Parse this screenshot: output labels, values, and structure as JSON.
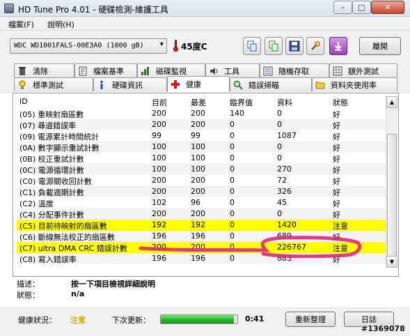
{
  "window": {
    "title": "HD Tune Pro 4.01 - 硬碟檢測-維護工具",
    "min_glyph": "–",
    "max_glyph": "□",
    "close_glyph": "✕"
  },
  "menu": {
    "items": [
      "檔案(F)",
      "說明(H)"
    ]
  },
  "toolbar": {
    "drive": "WDC WD1001FALS-00E3A0 (1000 gB)",
    "drive_arrow": "▼",
    "temperature": "45度C",
    "exit_label": "離開"
  },
  "tabs": {
    "row1": [
      "清除",
      "檔案基準",
      "磁碟監視",
      "工具",
      "隨機存取",
      "額外測試"
    ],
    "row2": [
      "標準測試",
      "硬碟資訊",
      "健康",
      "錯誤掃瞄",
      "資料夾使用率"
    ],
    "active": "健康"
  },
  "table": {
    "headers": [
      "ID",
      "目前",
      "最差",
      "臨界值",
      "資料",
      "狀態"
    ],
    "rows": [
      {
        "id": "(05) 重映射扇區數",
        "cur": "200",
        "worst": "200",
        "thr": "140",
        "data": "0",
        "status": "好"
      },
      {
        "id": "(07) 尋道錯誤率",
        "cur": "200",
        "worst": "200",
        "thr": "0",
        "data": "0",
        "status": "好"
      },
      {
        "id": "(09) 電源累計時間統計",
        "cur": "99",
        "worst": "99",
        "thr": "0",
        "data": "1087",
        "status": "好"
      },
      {
        "id": "(0A) 數字顯示重試計數",
        "cur": "100",
        "worst": "100",
        "thr": "0",
        "data": "0",
        "status": "好"
      },
      {
        "id": "(0B) 校正重試計數",
        "cur": "100",
        "worst": "100",
        "thr": "0",
        "data": "0",
        "status": "好"
      },
      {
        "id": "(0C) 電源循環計數",
        "cur": "100",
        "worst": "100",
        "thr": "0",
        "data": "270",
        "status": "好"
      },
      {
        "id": "(C0) 電源關收回計數",
        "cur": "200",
        "worst": "200",
        "thr": "0",
        "data": "72",
        "status": "好"
      },
      {
        "id": "(C1) 負載週期計數",
        "cur": "200",
        "worst": "200",
        "thr": "0",
        "data": "326",
        "status": "好"
      },
      {
        "id": "(C2) 溫度",
        "cur": "102",
        "worst": "96",
        "thr": "0",
        "data": "45",
        "status": "好"
      },
      {
        "id": "(C4) 分配事件計數",
        "cur": "200",
        "worst": "200",
        "thr": "0",
        "data": "0",
        "status": "好"
      },
      {
        "id": "(C5) 目前待映射的扇區數",
        "cur": "192",
        "worst": "192",
        "thr": "0",
        "data": "1420",
        "status": "注意",
        "warn": true
      },
      {
        "id": "(C6) 斷線無法校正的扇區數",
        "cur": "196",
        "worst": "196",
        "thr": "0",
        "data": "689",
        "status": "好"
      },
      {
        "id": "(C7) ultra DMA CRC 錯誤計數",
        "cur": "200",
        "worst": "200",
        "thr": "0",
        "data": "226767",
        "status": "注意",
        "warn": true
      },
      {
        "id": "(C8) 寫入錯誤率",
        "cur": "196",
        "worst": "196",
        "thr": "0",
        "data": "883",
        "status": "好"
      }
    ]
  },
  "details": {
    "desc_label": "描述：",
    "desc_value": "按一下項目檢視詳細說明",
    "status_label": "狀態：",
    "status_value": "n/a"
  },
  "statusbar": {
    "health_label": "健康狀況：",
    "health_value": "注意",
    "next_update_label": "下次更新：",
    "progress_fraction": 0.95,
    "countdown": "0:41",
    "refresh_label": "重新整理",
    "log_label": "日誌"
  },
  "watermark": "#1369078",
  "colors": {
    "warn_row": "#ffff00",
    "annotation": "#e0287a",
    "health_warning": "#d4b000",
    "progress": "#22b822"
  }
}
